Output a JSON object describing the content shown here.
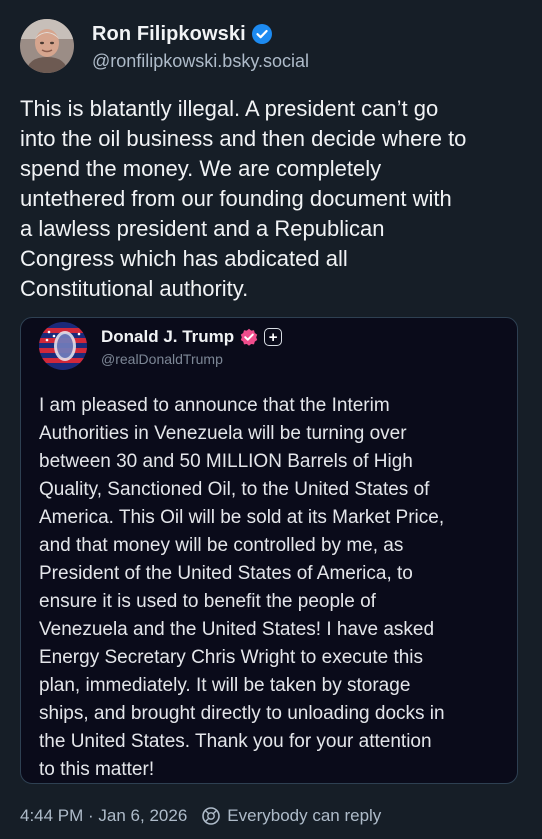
{
  "post": {
    "author": {
      "display_name": "Ron Filipkowski",
      "handle": "@ronfilipkowski.bsky.social",
      "verified_icon": "verified-check-icon"
    },
    "text": "This is blatantly illegal. A president can’t go\ninto the oil business and then decide where to\nspend the money. We are completely\nuntethered from our founding document with\na lawless president and a Republican\nCongress which has abdicated all\nConstitutional authority.",
    "quoted": {
      "author": {
        "display_name": "Donald J. Trump",
        "handle": "@realDonaldTrump",
        "badge_icon": "verified-badge-icon",
        "follow_icon": "plus-icon",
        "follow_glyph": "+"
      },
      "text": "I am pleased to announce that the Interim\nAuthorities in Venezuela will be turning over\nbetween 30 and 50 MILLION Barrels of High\nQuality, Sanctioned Oil, to the United States of\nAmerica. This Oil will be sold at its Market Price,\nand that money will be controlled by me, as\nPresident of the United States of America, to\nensure it is used to benefit the people of\nVenezuela and the United States! I have asked\nEnergy Secretary Chris Wright to execute this\nplan, immediately. It will be taken by storage\nships, and brought directly to unloading docks in\nthe United States. Thank you for your attention\nto this matter!"
    },
    "footer": {
      "timestamp": "4:44 PM · Jan 6, 2026",
      "reply_setting": "Everybody can reply",
      "reply_icon": "reply-settings-icon"
    }
  },
  "colors": {
    "background": "#161e27",
    "quote_background": "#0a0b1a",
    "quote_border": "#2e4052",
    "text_primary": "#f1f3f5",
    "text_secondary": "#aebbc9",
    "verified_blue": "#1d8bf1",
    "badge_pink": "#ef4d8c"
  }
}
